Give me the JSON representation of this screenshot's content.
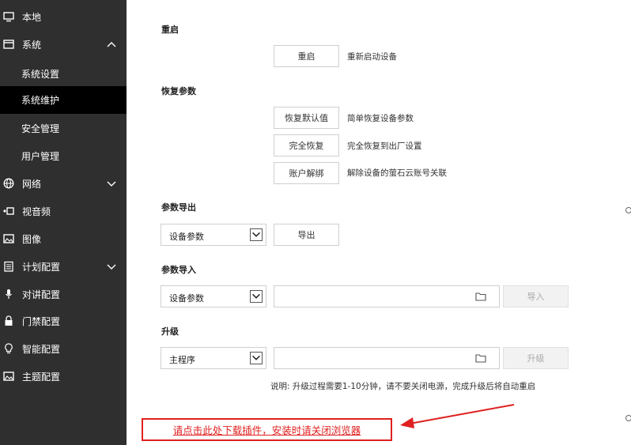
{
  "sidebar": {
    "items": [
      {
        "label": "本地",
        "icon": "monitor-icon"
      },
      {
        "label": "系统",
        "icon": "window-icon",
        "expanded": true
      },
      {
        "label": "系统设置"
      },
      {
        "label": "系统维护",
        "active": true
      },
      {
        "label": "安全管理"
      },
      {
        "label": "用户管理"
      },
      {
        "label": "网络",
        "icon": "globe-icon",
        "expandable": true
      },
      {
        "label": "视音频",
        "icon": "camera-icon"
      },
      {
        "label": "图像",
        "icon": "image-icon"
      },
      {
        "label": "计划配置",
        "icon": "calendar-icon",
        "expandable": true
      },
      {
        "label": "对讲配置",
        "icon": "microphone-icon"
      },
      {
        "label": "门禁配置",
        "icon": "lock-icon"
      },
      {
        "label": "智能配置",
        "icon": "bulb-icon"
      },
      {
        "label": "主题配置",
        "icon": "theme-icon"
      }
    ]
  },
  "main": {
    "restart": {
      "title": "重启",
      "button": "重启",
      "desc": "重新启动设备"
    },
    "restore": {
      "title": "恢复参数",
      "default_button": "恢复默认值",
      "default_desc": "简单恢复设备参数",
      "full_button": "完全恢复",
      "full_desc": "完全恢复到出厂设置",
      "unbind_button": "账户解绑",
      "unbind_desc": "解除设备的萤石云账号关联"
    },
    "export": {
      "title": "参数导出",
      "select_value": "设备参数",
      "button": "导出"
    },
    "import": {
      "title": "参数导入",
      "select_value": "设备参数",
      "file_value": "",
      "button": "导入"
    },
    "upgrade": {
      "title": "升级",
      "select_value": "主程序",
      "file_value": "",
      "button": "升级",
      "note": "说明: 升级过程需要1-10分钟，请不要关闭电源，完成升级后将自动重启"
    },
    "plugin_link": "请点击此处下载插件，安装时请关闭浏览器"
  },
  "colors": {
    "sidebar_bg": "#2f2f2f",
    "sidebar_active": "#000000",
    "annotation_red": "#e02020"
  }
}
